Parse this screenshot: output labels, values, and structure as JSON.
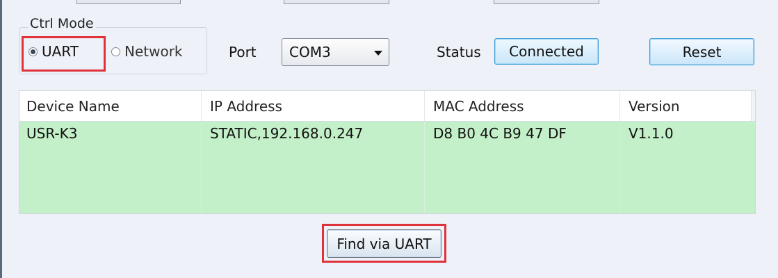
{
  "ctrl_mode": {
    "legend": "Ctrl Mode",
    "options": [
      {
        "label": "UART",
        "selected": true
      },
      {
        "label": "Network",
        "selected": false
      }
    ]
  },
  "port": {
    "label": "Port",
    "selected": "COM3"
  },
  "status": {
    "label": "Status",
    "value": "Connected"
  },
  "reset_label": "Reset",
  "table": {
    "columns": [
      "Device Name",
      "IP Address",
      "MAC Address",
      "Version"
    ],
    "rows": [
      [
        "USR-K3",
        "STATIC,192.168.0.247",
        "D8 B0 4C B9 47 DF",
        "V1.1.0"
      ]
    ]
  },
  "find_label": "Find via UART",
  "colors": {
    "highlight_red": "#e0323a",
    "row_green": "#c3f0c8",
    "button_blue": "#3c9ad6"
  }
}
